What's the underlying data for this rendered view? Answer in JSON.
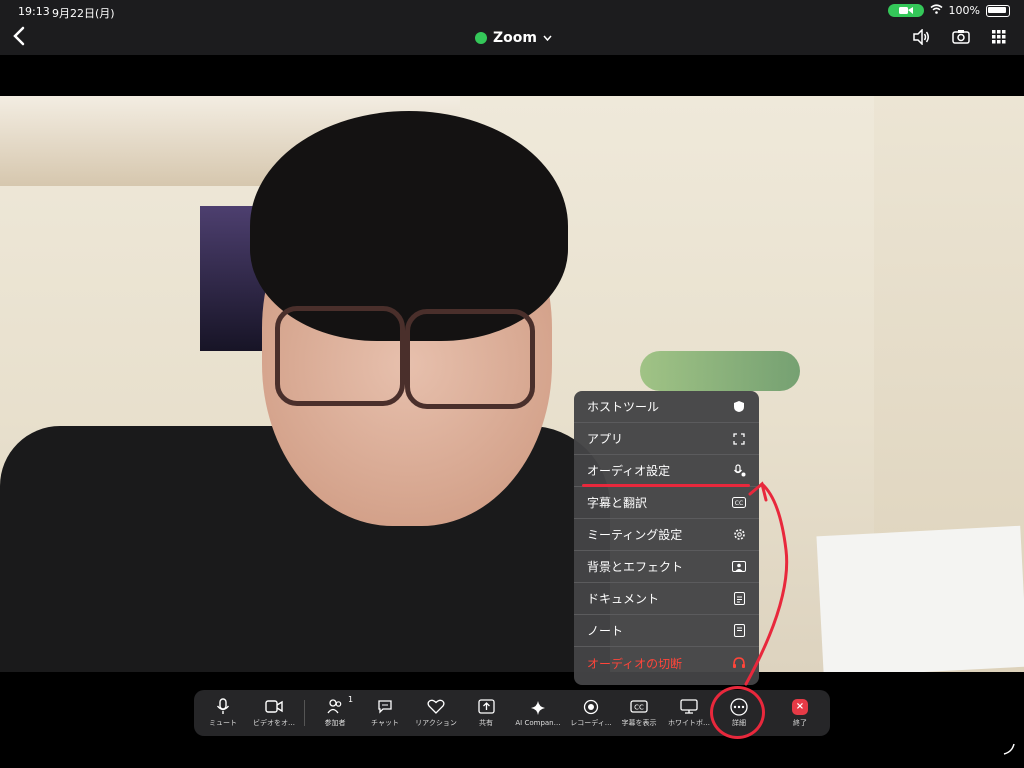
{
  "status": {
    "time": "19:13",
    "date": "9月22日(月)",
    "battery": "100%"
  },
  "header": {
    "title": "Zoom"
  },
  "menu": {
    "items": [
      {
        "label": "ホストツール",
        "icon": "shield-icon"
      },
      {
        "label": "アプリ",
        "icon": "apps-icon"
      },
      {
        "label": "オーディオ設定",
        "icon": "audio-settings-icon"
      },
      {
        "label": "字幕と翻訳",
        "icon": "cc-icon"
      },
      {
        "label": "ミーティング設定",
        "icon": "gear-icon"
      },
      {
        "label": "背景とエフェクト",
        "icon": "background-icon"
      },
      {
        "label": "ドキュメント",
        "icon": "document-icon"
      },
      {
        "label": "ノート",
        "icon": "notes-icon"
      },
      {
        "label": "オーディオの切断",
        "icon": "headphone-icon"
      }
    ]
  },
  "toolbar": {
    "mute": "ミュート",
    "video": "ビデオをオ…",
    "participants": "参加者",
    "participants_count": "1",
    "chat": "チャット",
    "reaction": "リアクション",
    "share": "共有",
    "ai": "AI Compan…",
    "record": "レコーディ…",
    "captions": "字幕を表示",
    "whiteboard": "ホワイトボ…",
    "more": "詳細",
    "end": "終了"
  },
  "colors": {
    "accent_red": "#e8283c",
    "danger": "#ff453a",
    "green": "#34c759"
  }
}
